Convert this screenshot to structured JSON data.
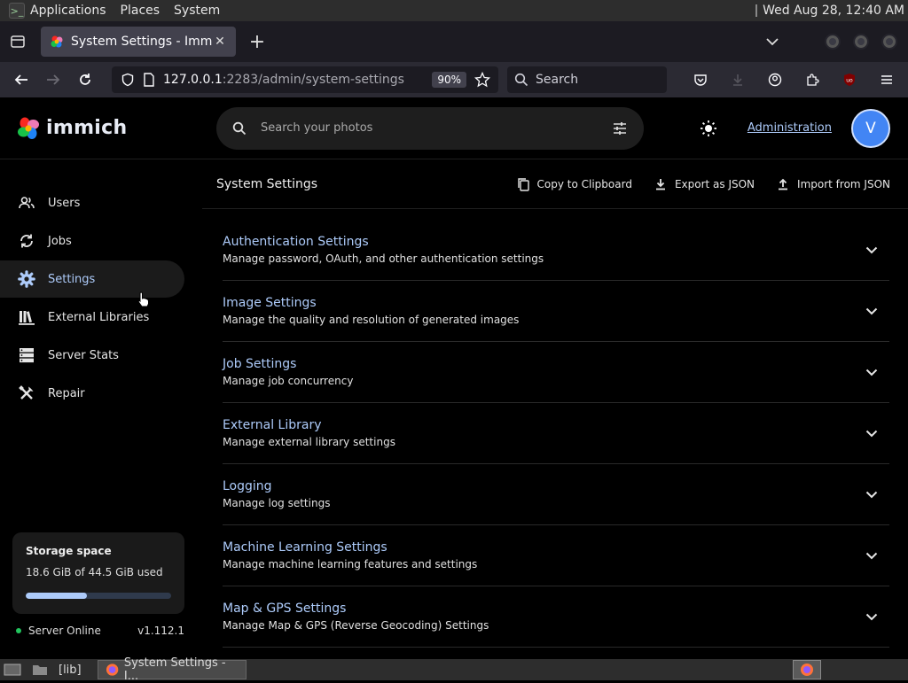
{
  "os_panel": {
    "menus": [
      "Applications",
      "Places",
      "System"
    ],
    "clock": "Wed Aug 28, 12:40 AM"
  },
  "browser": {
    "tab_title": "System Settings - Immich",
    "url_host": "127.0.0.1",
    "url_path": ":2283/admin/system-settings",
    "zoom": "90%",
    "search_placeholder": "Search"
  },
  "app": {
    "brand": "immich",
    "search_placeholder": "Search your photos",
    "admin_link": "Administration",
    "avatar_initial": "V"
  },
  "sidebar": {
    "items": [
      {
        "label": "Users",
        "icon": "users-icon"
      },
      {
        "label": "Jobs",
        "icon": "sync-icon"
      },
      {
        "label": "Settings",
        "icon": "gear-icon"
      },
      {
        "label": "External Libraries",
        "icon": "library-icon"
      },
      {
        "label": "Server Stats",
        "icon": "server-icon"
      },
      {
        "label": "Repair",
        "icon": "tools-icon"
      }
    ],
    "active_index": 2,
    "storage": {
      "title": "Storage space",
      "usage": "18.6 GiB of 44.5 GiB used",
      "used_fraction": 0.418
    },
    "server_status": "Server Online",
    "version": "v1.112.1"
  },
  "main": {
    "title": "System Settings",
    "actions": {
      "copy": "Copy to Clipboard",
      "export": "Export as JSON",
      "import": "Import from JSON"
    },
    "sections": [
      {
        "title": "Authentication Settings",
        "desc": "Manage password, OAuth, and other authentication settings"
      },
      {
        "title": "Image Settings",
        "desc": "Manage the quality and resolution of generated images"
      },
      {
        "title": "Job Settings",
        "desc": "Manage job concurrency"
      },
      {
        "title": "External Library",
        "desc": "Manage external library settings"
      },
      {
        "title": "Logging",
        "desc": "Manage log settings"
      },
      {
        "title": "Machine Learning Settings",
        "desc": "Manage machine learning features and settings"
      },
      {
        "title": "Map & GPS Settings",
        "desc": "Manage Map & GPS (Reverse Geocoding) Settings"
      }
    ]
  },
  "taskbar": {
    "folder_label": "[lib]",
    "window_label": "System Settings - I..."
  },
  "colors": {
    "accent": "#adcbfa",
    "avatar": "#4285f4",
    "online": "#22c55e"
  }
}
